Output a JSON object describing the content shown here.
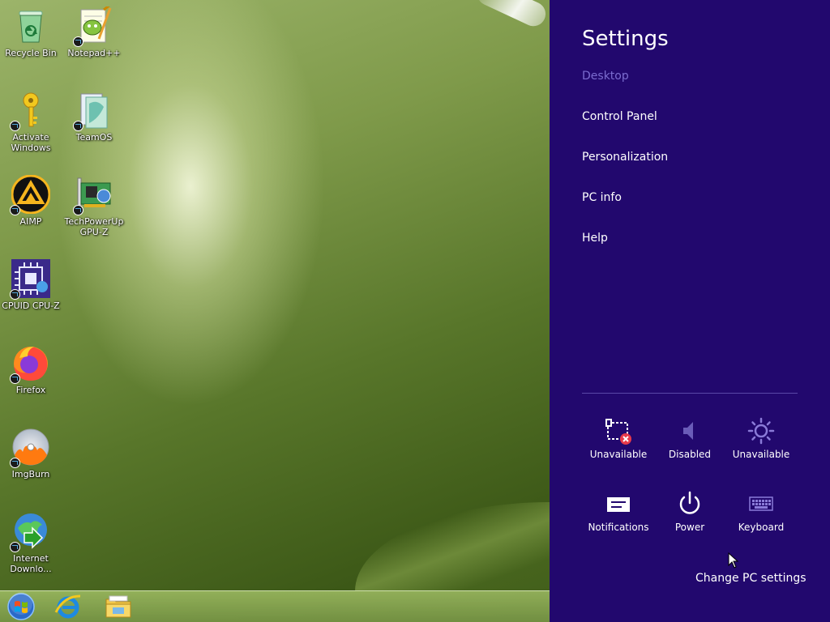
{
  "desktop": {
    "icons": [
      {
        "name": "recycle-bin-icon",
        "label": "Recycle Bin"
      },
      {
        "name": "notepad-plus-plus-icon",
        "label": "Notepad++"
      },
      {
        "name": "activate-windows-icon",
        "label": "Activate Windows"
      },
      {
        "name": "teamos-icon",
        "label": "TeamOS"
      },
      {
        "name": "aimp-icon",
        "label": "AIMP"
      },
      {
        "name": "gpu-z-icon",
        "label": "TechPowerUp GPU-Z"
      },
      {
        "name": "cpu-z-icon",
        "label": "CPUID CPU-Z"
      },
      {
        "name": "firefox-icon",
        "label": "Firefox"
      },
      {
        "name": "imgburn-icon",
        "label": "ImgBurn"
      },
      {
        "name": "internet-download-manager-icon",
        "label": "Internet Downlo..."
      }
    ]
  },
  "taskbar": {
    "items": [
      "start-button",
      "internet-explorer-icon",
      "file-explorer-icon"
    ]
  },
  "settings": {
    "title": "Settings",
    "section": "Desktop",
    "links": [
      "Control Panel",
      "Personalization",
      "PC info",
      "Help"
    ],
    "tiles": [
      {
        "label": "Unavailable",
        "icon": "network-unavailable-icon"
      },
      {
        "label": "Disabled",
        "icon": "volume-disabled-icon"
      },
      {
        "label": "Unavailable",
        "icon": "brightness-icon"
      },
      {
        "label": "Notifications",
        "icon": "notifications-icon"
      },
      {
        "label": "Power",
        "icon": "power-icon"
      },
      {
        "label": "Keyboard",
        "icon": "keyboard-icon"
      }
    ],
    "change_pc_settings": "Change PC settings"
  },
  "colors": {
    "charm_bg": "#22086e",
    "section_text": "#7b6ccf"
  }
}
